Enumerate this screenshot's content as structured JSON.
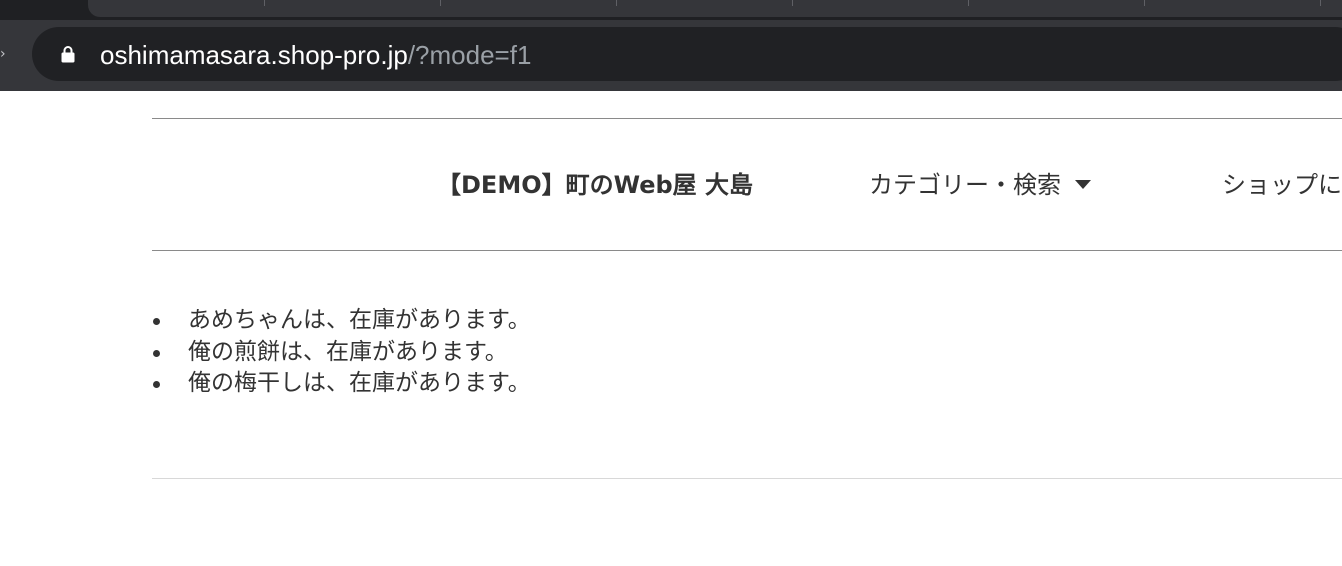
{
  "browser": {
    "url_host": "oshimamasara.shop-pro.jp",
    "url_path": "/?mode=f1",
    "lock_icon": "lock-icon"
  },
  "header": {
    "shop_name": "【DEMO】町のWeb屋 大島",
    "nav_category": "カテゴリー・検索",
    "nav_shop": "ショップに"
  },
  "stock": {
    "items": [
      "あめちゃんは、在庫があります。",
      "俺の煎餅は、在庫があります。",
      "俺の梅干しは、在庫があります。"
    ]
  },
  "colors": {
    "text": "#333333",
    "rule": "#8a8a8a",
    "browser_chrome": "#35363a",
    "link": "#2a7ab8"
  }
}
